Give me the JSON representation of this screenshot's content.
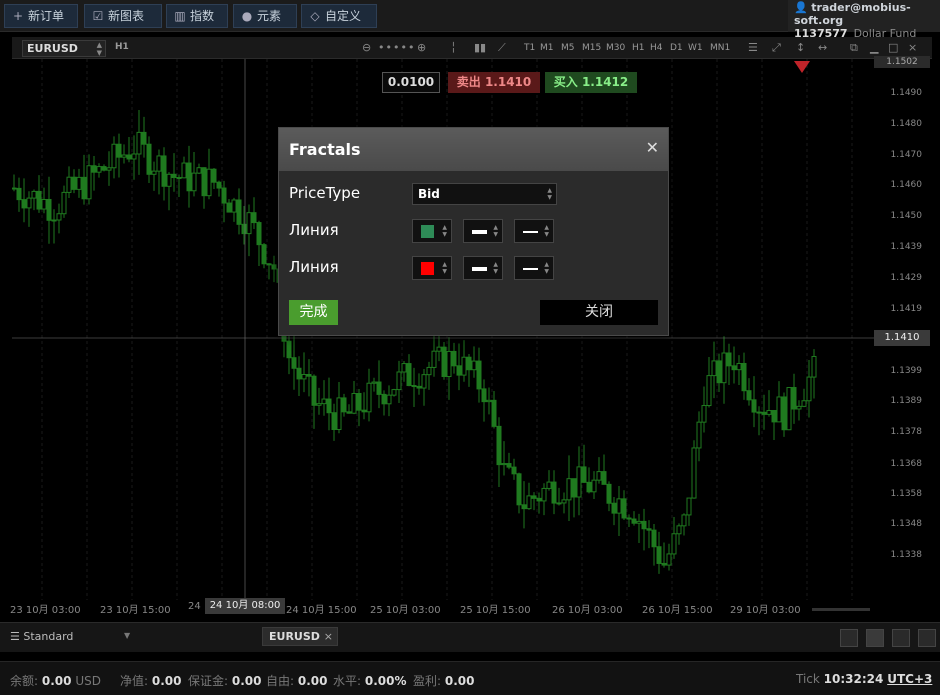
{
  "toolbar": {
    "new_order": "新订单",
    "new_chart": "新图表",
    "indicators": "指数",
    "elements": "元素",
    "custom": "自定义",
    "new_order_icon": "plus-icon",
    "new_chart_icon": "chart-icon",
    "indicators_icon": "bar-chart-icon",
    "elements_icon": "shapes-icon",
    "custom_icon": "diamond-icon"
  },
  "account": {
    "email": "trader@mobius-soft.org",
    "number": "1137577",
    "fund": "Dollar Fund"
  },
  "chart": {
    "symbol": "EURUSD",
    "timeframe": "H1",
    "timeframes": [
      "T1",
      "M1",
      "M5",
      "M15",
      "M30",
      "H1",
      "H4",
      "D1",
      "W1",
      "MN1"
    ],
    "lot": "0.0100",
    "sell_label": "卖出",
    "sell_price": "1.1410",
    "buy_label": "买入",
    "buy_price": "1.1412",
    "current_price": "1.1410",
    "top_price": "1.1502",
    "current_time": "24 10月 08:00"
  },
  "chart_data": {
    "type": "candlestick",
    "price_ticks": [
      "1.1490",
      "1.1480",
      "1.1470",
      "1.1460",
      "1.1450",
      "1.1439",
      "1.1429",
      "1.1419",
      "1.1399",
      "1.1389",
      "1.1378",
      "1.1368",
      "1.1358",
      "1.1348",
      "1.1338"
    ],
    "time_ticks": [
      "23 10月 03:00",
      "23 10月 15:00",
      "24",
      "24 10月 15:00",
      "25 10月 03:00",
      "25 10月 15:00",
      "26 10月 03:00",
      "26 10月 15:00",
      "29 10月 03:00"
    ],
    "ylim": [
      1.133,
      1.1502
    ],
    "grid": true
  },
  "dialog": {
    "title": "Fractals",
    "price_type_label": "PriceType",
    "price_type_value": "Bid",
    "line1_label": "Линия",
    "line2_label": "Линия",
    "line1_color": "#2e8b57",
    "line2_color": "#ff0000",
    "done_label": "完成",
    "close_label": "关闭"
  },
  "lower": {
    "preset": "Standard",
    "tab": "EURUSD"
  },
  "status": {
    "balance_label": "余额:",
    "balance_value": "0.00",
    "currency": "USD",
    "equity_label": "净值:",
    "equity_value": "0.00",
    "margin_label": "保证金:",
    "margin_value": "0.00",
    "free_label": "自由:",
    "free_value": "0.00",
    "level_label": "水平:",
    "level_value": "0.00%",
    "profit_label": "盈利:",
    "profit_value": "0.00",
    "tick_label": "Tick",
    "time": "10:32:24",
    "timezone": "UTC+3"
  }
}
